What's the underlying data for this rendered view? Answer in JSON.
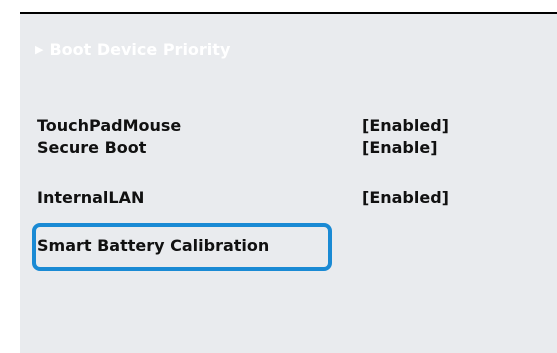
{
  "bios": {
    "boot_device_priority": {
      "arrow": "▶",
      "label": "Boot Device Priority"
    },
    "settings": [
      {
        "label": "TouchPadMouse",
        "value": "[Enabled]"
      },
      {
        "label": "Secure Boot",
        "value": "[Enable]"
      },
      {
        "label": "InternalLAN",
        "value": "[Enabled]"
      }
    ],
    "smart_battery_calibration": "Smart Battery Calibration"
  },
  "colors": {
    "panel_background": "#e9ebee",
    "highlight_border": "#1a8ad4",
    "text": "#111111"
  }
}
